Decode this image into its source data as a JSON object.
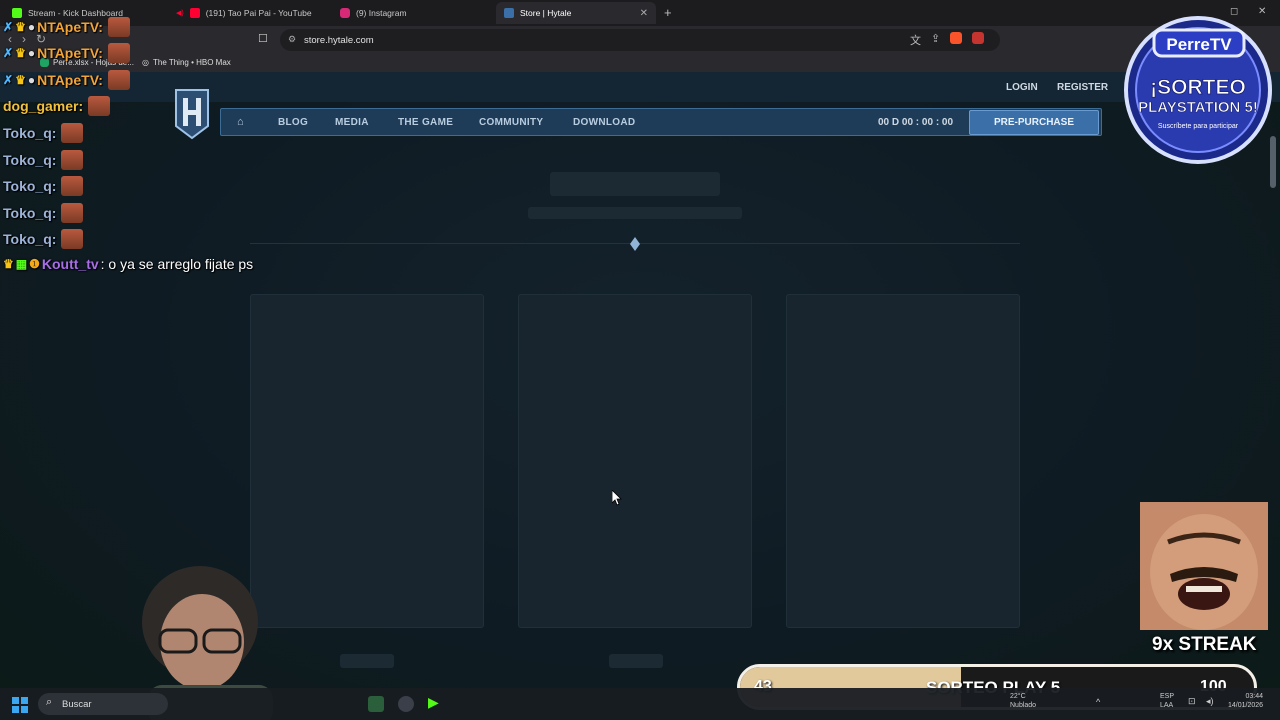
{
  "browser": {
    "tabs": [
      {
        "label": "Stream - Kick Dashboard",
        "color": "#53fc18"
      },
      {
        "label": "(191) Tao Pai Pai - YouTube",
        "color": "#ff0033"
      },
      {
        "label": "(9) Instagram",
        "color": "#d62976"
      },
      {
        "label": "Store | Hytale",
        "color": "#3a6fa8"
      }
    ],
    "new_tab": "+",
    "url": "store.hytale.com",
    "bookmarks": [
      {
        "label": "Perre.xlsx - Hojas de..."
      },
      {
        "label": "The Thing • HBO Max"
      }
    ]
  },
  "site": {
    "login": "LOGIN",
    "register": "REGISTER",
    "nav": {
      "blog": "BLOG",
      "media": "MEDIA",
      "the_game": "THE GAME",
      "community": "COMMUNITY",
      "download": "DOWNLOAD"
    },
    "countdown": "00 D 00 : 00 : 00",
    "prepurchase": "PRE-PURCHASE"
  },
  "chat": {
    "messages": [
      {
        "user": "NTApeTV:",
        "color": "#f2a43a"
      },
      {
        "user": "NTApeTV:",
        "color": "#f2a43a"
      },
      {
        "user": "NTApeTV:",
        "color": "#f2a43a"
      },
      {
        "user": "dog_gamer:",
        "color": "#f0c040"
      },
      {
        "user": "Toko_q:",
        "color": "#9db3d8"
      },
      {
        "user": "Toko_q:",
        "color": "#9db3d8"
      },
      {
        "user": "Toko_q:",
        "color": "#9db3d8"
      },
      {
        "user": "Toko_q:",
        "color": "#9db3d8"
      },
      {
        "user": "Toko_q:",
        "color": "#9db3d8"
      },
      {
        "user": "Koutt_tv",
        "color": "#a86ee8",
        "text": ": o ya se arreglo fijate ps"
      }
    ]
  },
  "overlay": {
    "perre_brand": "PerreTV",
    "perre_line1": "¡SORTEO",
    "perre_line2": "PLAYSTATION 5!",
    "perre_sub": "Suscríbete para participar",
    "streak": "9x STREAK",
    "sorteo": {
      "current": "43",
      "title": "SORTEO PLAY 5",
      "goal": "100",
      "progress": 0.43
    }
  },
  "taskbar": {
    "search": "Buscar",
    "weather": "22°C",
    "weather_sub": "Nublado",
    "lang": "ESP",
    "lang_sub": "LAA",
    "time": "03:44",
    "date": "14/01/2026"
  }
}
